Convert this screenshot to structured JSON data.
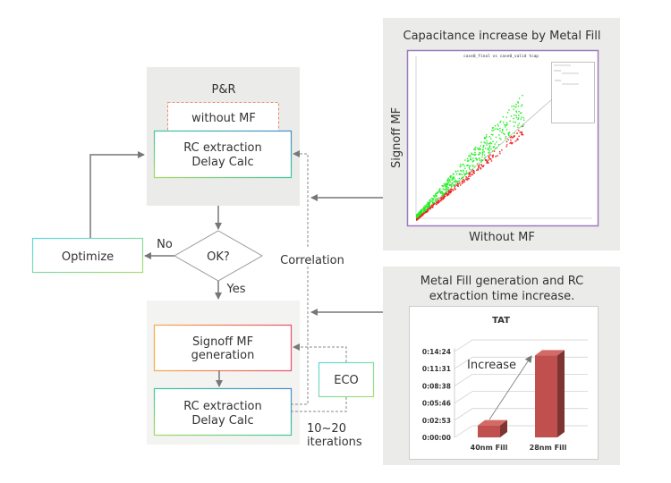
{
  "flow": {
    "pr_group_label": "P&R",
    "without_mf": "without MF",
    "rc_top": [
      "RC extraction",
      "Delay Calc"
    ],
    "decision": "OK?",
    "no_label": "No",
    "yes_label": "Yes",
    "optimize": "Optimize",
    "correlation": "Correlation",
    "signoff_mf": [
      "Signoff MF",
      "generation"
    ],
    "rc_bottom": [
      "RC extraction",
      "Delay Calc"
    ],
    "eco": "ECO",
    "iterations": [
      "10~20",
      "iterations"
    ]
  },
  "scatter_panel": {
    "title": "Capacitance increase by Metal Fill",
    "ylabel": "Signoff MF",
    "xlabel": "Without MF",
    "plot_title": "case0_final vs case0_valid tcap",
    "colors": {
      "above": "#22ee22",
      "below": "#ee2222",
      "frame": "#9b7bbf",
      "diagonal": "#bbbbbb"
    }
  },
  "bar_panel": {
    "title": [
      "Metal Fill generation and RC",
      "extraction time increase."
    ],
    "annotation": "Increase"
  },
  "chart_data": {
    "type": "bar",
    "title": "TAT",
    "categories": [
      "40nm Fill",
      "28nm Fill"
    ],
    "values": [
      "0:02:00",
      "0:13:45"
    ],
    "yticks": [
      "0:00:00",
      "0:02:53",
      "0:05:46",
      "0:08:38",
      "0:11:31",
      "0:14:24"
    ],
    "ylim": [
      "0:00:00",
      "0:14:24"
    ],
    "grid": true,
    "bar_color": "#c0504d"
  }
}
